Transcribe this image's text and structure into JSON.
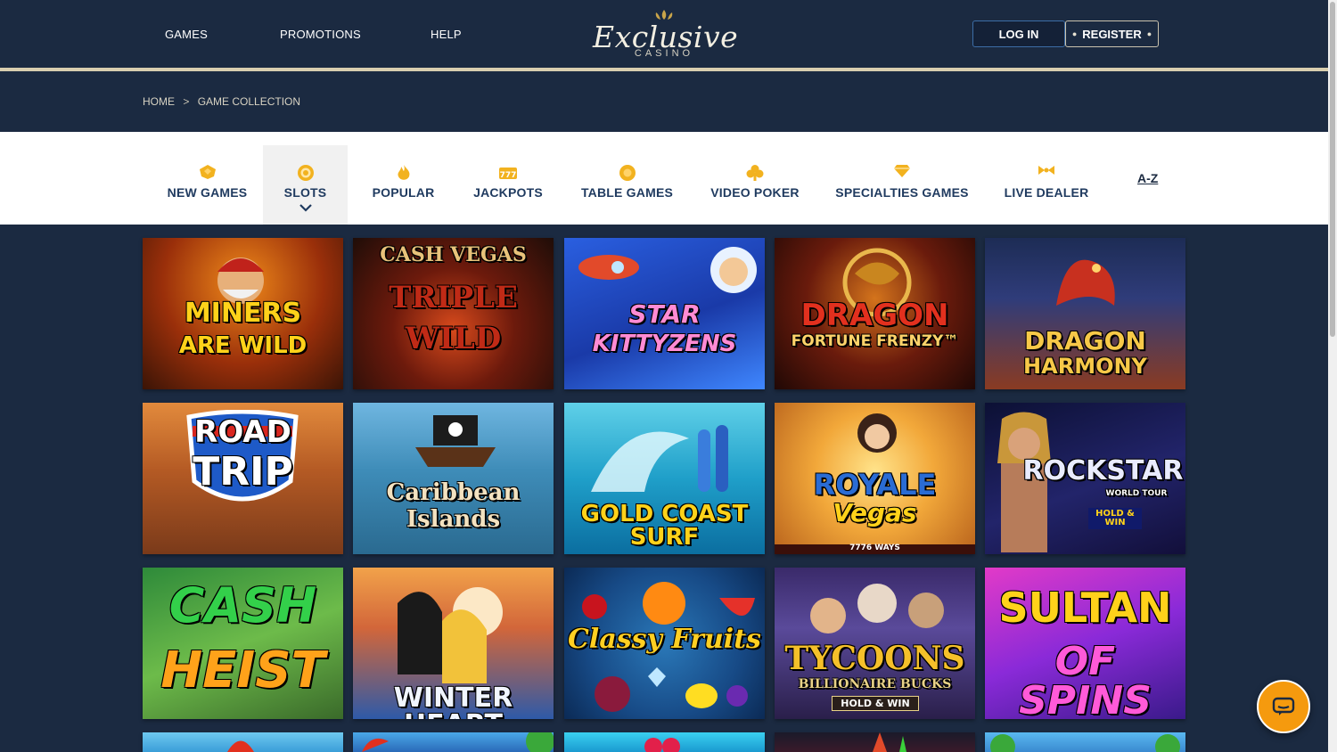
{
  "nav": {
    "games": "GAMES",
    "promotions": "PROMOTIONS",
    "help": "HELP"
  },
  "logo": {
    "script": "Exclusive",
    "sub": "CASINO"
  },
  "auth": {
    "login": "LOG IN",
    "register": "REGISTER"
  },
  "breadcrumb": {
    "home": "HOME",
    "separator": ">",
    "current": "GAME COLLECTION"
  },
  "categories": [
    {
      "label": "NEW GAMES",
      "icon": "new-games-icon"
    },
    {
      "label": "SLOTS",
      "icon": "slots-icon",
      "active": true
    },
    {
      "label": "POPULAR",
      "icon": "popular-icon"
    },
    {
      "label": "JACKPOTS",
      "icon": "jackpots-icon"
    },
    {
      "label": "TABLE GAMES",
      "icon": "table-games-icon"
    },
    {
      "label": "VIDEO POKER",
      "icon": "video-poker-icon"
    },
    {
      "label": "SPECIALTIES GAMES",
      "icon": "specialties-icon"
    },
    {
      "label": "LIVE DEALER",
      "icon": "live-dealer-icon"
    }
  ],
  "az_label": "A-Z",
  "games": [
    {
      "title1": "MINERS",
      "title2": "ARE WILD"
    },
    {
      "title1": "CASH VEGAS",
      "title2": "TRIPLE WILD"
    },
    {
      "title1": "STAR",
      "title2": "KITTYZENS"
    },
    {
      "title1": "DRAGON",
      "title2": "FORTUNE FRENZY™"
    },
    {
      "title1": "DRAGON",
      "title2": "HARMONY"
    },
    {
      "title1": "ROAD",
      "title2": "TRIP"
    },
    {
      "title1": "Caribbean",
      "title2": "Islands"
    },
    {
      "title1": "GOLD COAST SURF",
      "title2": ""
    },
    {
      "title1": "ROYALE",
      "title2": "Vegas",
      "extra": "7776 WAYS"
    },
    {
      "title1": "ROCKSTAR",
      "title2": "WORLD TOUR",
      "extra": "HOLD & WIN"
    },
    {
      "title1": "CASH",
      "title2": "HEIST"
    },
    {
      "title1": "WINTER HEART",
      "title2": ""
    },
    {
      "title1": "Classy Fruits",
      "title2": ""
    },
    {
      "title1": "TYCOONS",
      "title2": "BILLIONAIRE BUCKS",
      "extra": "HOLD & WIN"
    },
    {
      "title1": "SULTAN",
      "title2": "OF SPINS"
    }
  ],
  "colors": {
    "navy": "#1b2a41",
    "gold": "#d9ceaf",
    "category_text": "#1f3a5f",
    "icon_gold": "#f2b21f",
    "chat_orange": "#f59a0e"
  }
}
